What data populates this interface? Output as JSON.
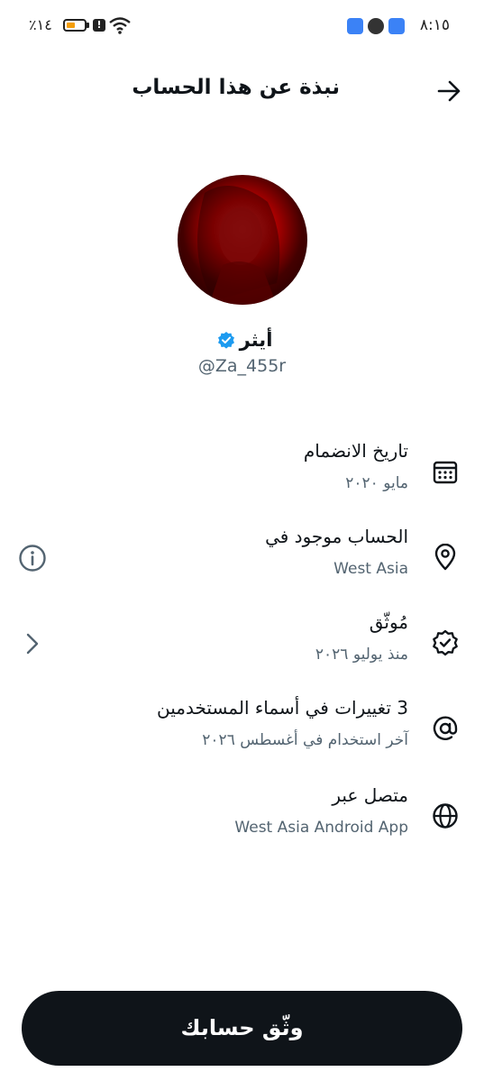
{
  "status_bar": {
    "time": "٨:١٥",
    "battery": "٪١٤",
    "battery_level": 0.14,
    "alert": "!"
  },
  "header": {
    "title": "نبذة عن هذا الحساب"
  },
  "profile": {
    "name": "أيثر",
    "handle": "@Za_455r",
    "verified_color": "#1d9bf0"
  },
  "rows": [
    {
      "icon": "calendar-icon",
      "title": "تاريخ الانضمام",
      "subtitle": "مايو ٢٠٢٠"
    },
    {
      "icon": "location-pin-icon",
      "title": "الحساب موجود في",
      "subtitle": "West Asia",
      "trailing": "info-icon"
    },
    {
      "icon": "verified-badge-icon",
      "title": "مُوثّق",
      "subtitle": "منذ يوليو ٢٠٢٦",
      "trailing": "chevron-left-icon"
    },
    {
      "icon": "at-sign-icon",
      "title": "3 تغييرات في أسماء المستخدمين",
      "subtitle": "آخر استخدام في أغسطس ٢٠٢٦"
    },
    {
      "icon": "globe-icon",
      "title": "متصل عبر",
      "subtitle": "West Asia Android App"
    }
  ],
  "cta": {
    "label": "وثّق حسابك",
    "background": "#0f1419",
    "color": "#ffffff"
  }
}
